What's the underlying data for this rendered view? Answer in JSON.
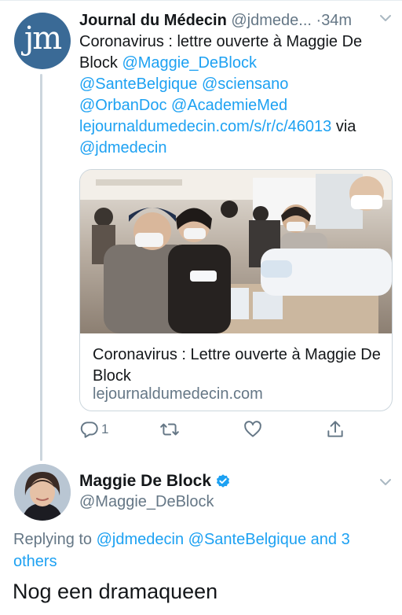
{
  "tweet1": {
    "display_name": "Journal du Médecin",
    "handle": "@jdmede...",
    "separator": "·",
    "time": "34m",
    "avatar_text": "jm",
    "body": {
      "text": "Coronavirus : lettre ouverte à Maggie De Block",
      "mentions": [
        "@Maggie_DeBlock",
        "@SanteBelgique",
        "@sciensano",
        "@OrbanDoc",
        "@AcademieMed"
      ],
      "url": "lejournaldumedecin.com/s/r/c/46013",
      "via_word": "via",
      "via_handle": "@jdmedecin"
    },
    "card": {
      "title": "Coronavirus : Lettre ouverte à Maggie De Block",
      "domain": "lejournaldumedecin.com"
    },
    "actions": {
      "reply_count": "1"
    }
  },
  "tweet2": {
    "display_name": "Maggie De Block",
    "handle": "@Maggie_DeBlock",
    "replying_prefix": "Replying to",
    "replying_handles": [
      "@jdmedecin",
      "@SanteBelgique"
    ],
    "replying_more": "and 3 others",
    "text": "Nog een dramaqueen"
  },
  "colors": {
    "link": "#1da1f2",
    "muted": "#657786",
    "text": "#14171a",
    "border": "#ccd6dd",
    "verified": "#1da1f2",
    "avatar_jm": "#3a6a96"
  }
}
